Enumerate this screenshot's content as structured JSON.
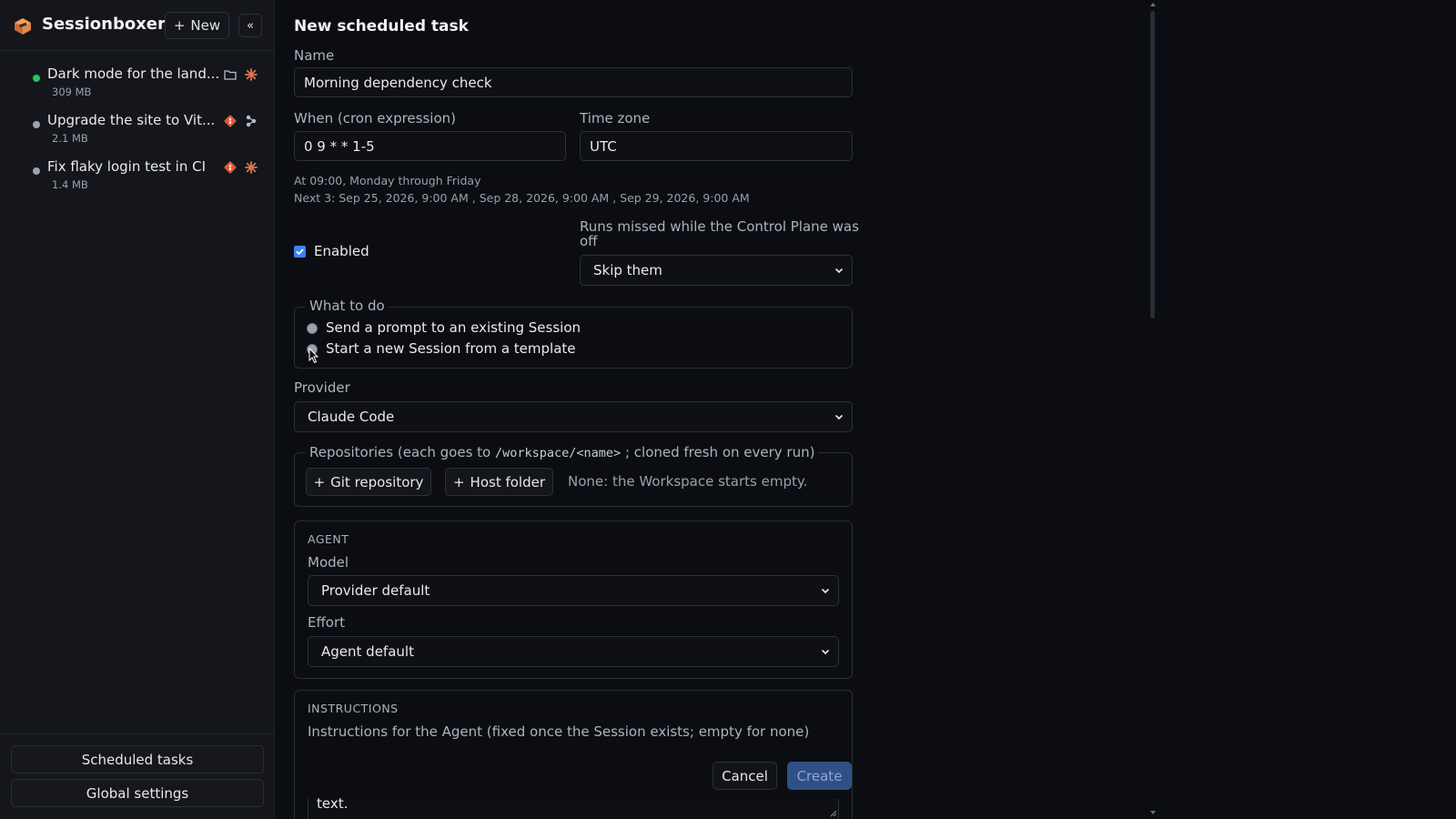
{
  "app": {
    "title": "Sessionboxer",
    "new_label": "New",
    "collapse_glyph": "«"
  },
  "sessions": [
    {
      "title": "Dark mode for the land...",
      "size": "309 MB",
      "status_color": "#22c55e",
      "icons": [
        "folder-icon",
        "claude-icon"
      ]
    },
    {
      "title": "Upgrade the site to Vit...",
      "size": "2.1 MB",
      "status_color": "#9ca3af",
      "icons": [
        "git-icon",
        "branch-icon"
      ]
    },
    {
      "title": "Fix flaky login test in CI",
      "size": "1.4 MB",
      "status_color": "#9ca3af",
      "icons": [
        "git-icon",
        "claude-icon"
      ]
    }
  ],
  "sidebar_footer": {
    "scheduled_tasks": "Scheduled tasks",
    "global_settings": "Global settings"
  },
  "form": {
    "title": "New scheduled task",
    "name_label": "Name",
    "name_value": "Morning dependency check",
    "cron_label": "When (cron expression)",
    "cron_value": "0 9 * * 1-5",
    "tz_label": "Time zone",
    "tz_value": "UTC",
    "cron_desc": "At 09:00, Monday through Friday",
    "next_prefix": "Next 3:",
    "next_runs": "Sep 25, 2026, 9:00 AM ,  Sep 28, 2026, 9:00 AM ,  Sep 29, 2026, 9:00 AM",
    "enabled_label": "Enabled",
    "enabled": true,
    "missed_label_1": "Runs missed while the Control Plane was",
    "missed_label_2": "off",
    "missed_value": "Skip them",
    "what_legend": "What to do",
    "what_options": [
      "Send a prompt to an existing Session",
      "Start a new Session from a template"
    ],
    "provider_label": "Provider",
    "provider_value": "Claude Code",
    "repos_legend_a": "Repositories (each goes to ",
    "repos_legend_code": "/workspace/<name>",
    "repos_legend_b": "; cloned fresh on every run)",
    "git_repo_btn": "Git repository",
    "host_folder_btn": "Host folder",
    "repos_empty": "None: the Workspace starts empty.",
    "agent_caption": "AGENT",
    "model_label": "Model",
    "model_value": "Provider default",
    "effort_label": "Effort",
    "effort_value": "Agent default",
    "instructions_caption": "INSTRUCTIONS",
    "instructions_label": "Instructions for the Agent (fixed once the Session exists; empty for none)",
    "instructions_tail": "text.",
    "cancel": "Cancel",
    "create": "Create"
  },
  "colors": {
    "accent": "#3b82f6",
    "create_bg": "#2f4f86",
    "create_text": "#8fa7cf"
  }
}
